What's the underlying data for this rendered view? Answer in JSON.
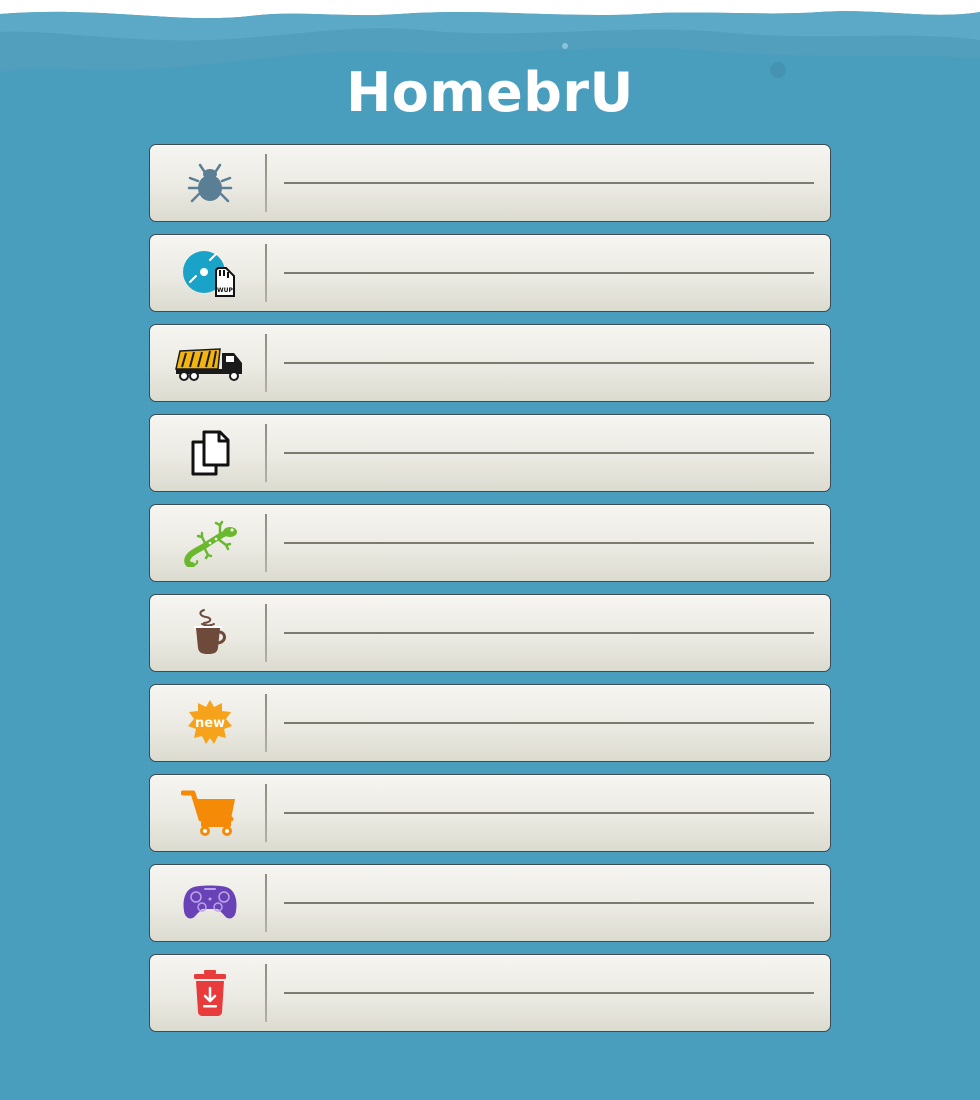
{
  "app": {
    "title": "HomebrU"
  },
  "menu": {
    "items": [
      {
        "icon": "bug-icon",
        "label": ""
      },
      {
        "icon": "disc-sd-card-icon",
        "label": ""
      },
      {
        "icon": "truck-icon",
        "label": ""
      },
      {
        "icon": "copy-files-icon",
        "label": ""
      },
      {
        "icon": "gecko-icon",
        "label": ""
      },
      {
        "icon": "coffee-cup-icon",
        "label": ""
      },
      {
        "icon": "new-badge-icon",
        "label": ""
      },
      {
        "icon": "shopping-cart-icon",
        "label": ""
      },
      {
        "icon": "gamepad-icon",
        "label": ""
      },
      {
        "icon": "trash-download-icon",
        "label": ""
      }
    ]
  },
  "colors": {
    "background": "#4a9ebd",
    "title": "#ffffff",
    "bug": "#5a7f95",
    "disc": "#1aa3c8",
    "truck": "#f2b40f",
    "gecko": "#6ab82e",
    "coffee": "#6d4a3a",
    "new_badge": "#f7a21b",
    "cart": "#f58a07",
    "gamepad": "#6a42b8",
    "trash": "#e83b3b"
  },
  "icons": {
    "sd_card_text": "WUP",
    "new_badge_text": "new"
  }
}
